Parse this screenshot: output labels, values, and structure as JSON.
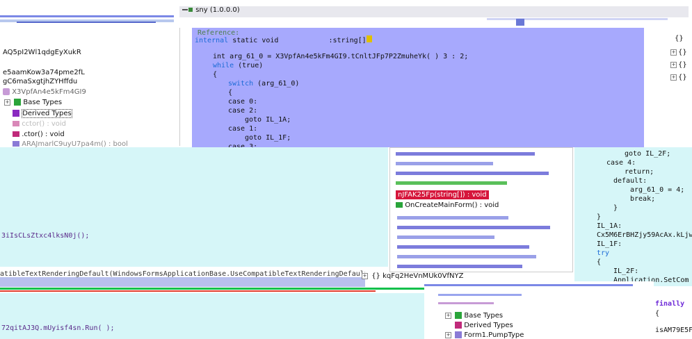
{
  "colors": {
    "code_bg": "#a7a9fd",
    "cyan_bg": "#d6f6f8",
    "highlight_red": "#d6163b",
    "line_green": "#10c04b",
    "line_red": "#e03c2b"
  },
  "assembly_label": "sny (1.0.0.0)",
  "left_tree": {
    "items": [
      "AQ5pI2Wl1qdgEyXukR",
      "e5aamKow3a74pme2fL",
      "gC6maSxgtjhZYHffdu",
      "X3VpfAn4e5kFm4GI9",
      "Base Types",
      "Derived Types",
      "cctor() : void",
      ".ctor() : void",
      "ARAJmarlC9uyU7pa4m() : bool"
    ]
  },
  "code_top": {
    "comment": "Reference:",
    "line1_a": "internal",
    "line1_b": "static void",
    "line1_c": ":string[]",
    "line2": "int arg_61_0 = X3VpfAn4e5kFm4GI9.tCnltJFp7P2ZmuheYk( ) 3 : 2;",
    "line3_kw": "while",
    "line3_rest": "(true)",
    "line4": "{",
    "line5_kw": "switch",
    "line5_rest": "(arg_61_0)",
    "line6": "{",
    "line7": "case 0:",
    "line8": "case 2:",
    "line9": "goto IL_1A;",
    "line10": "case 1:",
    "line11": "goto IL_1F;",
    "line12": "case 3:"
  },
  "code_right": {
    "lines": [
      "goto IL_2F;",
      "case 4:",
      "return;",
      "default:",
      "arg_61_0 = 4;",
      "break;",
      "}",
      "}",
      "IL_1A:",
      "Cx5M6ErBHZjy59AcAx.kLjw",
      "IL_1F:",
      "try",
      "{",
      "IL_2F:",
      "Application.SetCom"
    ],
    "finally": "finally",
    "brace": "{",
    "tail": "isAM79E5F"
  },
  "cyan_left": {
    "line_a": "3iIsCLsZtxc4lksN0j();",
    "line_b": "atibleTextRenderingDefault(WindowsFormsApplicationBase.UseCompatibleTextRenderingDefault",
    "line_c": "72qitAJ3Q.mUyisf4sn.Run( );"
  },
  "popup_list": {
    "selected": "nJFAK25Fp(string[]) : void",
    "items": [
      "OnCreateMainForm() : void"
    ],
    "namespace": "kqFq2HeVnMUk0VfNYZ"
  },
  "bottom_tree": {
    "items": [
      "Base Types",
      "Derived Types",
      "Form1.PumpType"
    ]
  },
  "right_tree": {
    "items": [
      "{}",
      "{}",
      "{}",
      "{}"
    ]
  }
}
